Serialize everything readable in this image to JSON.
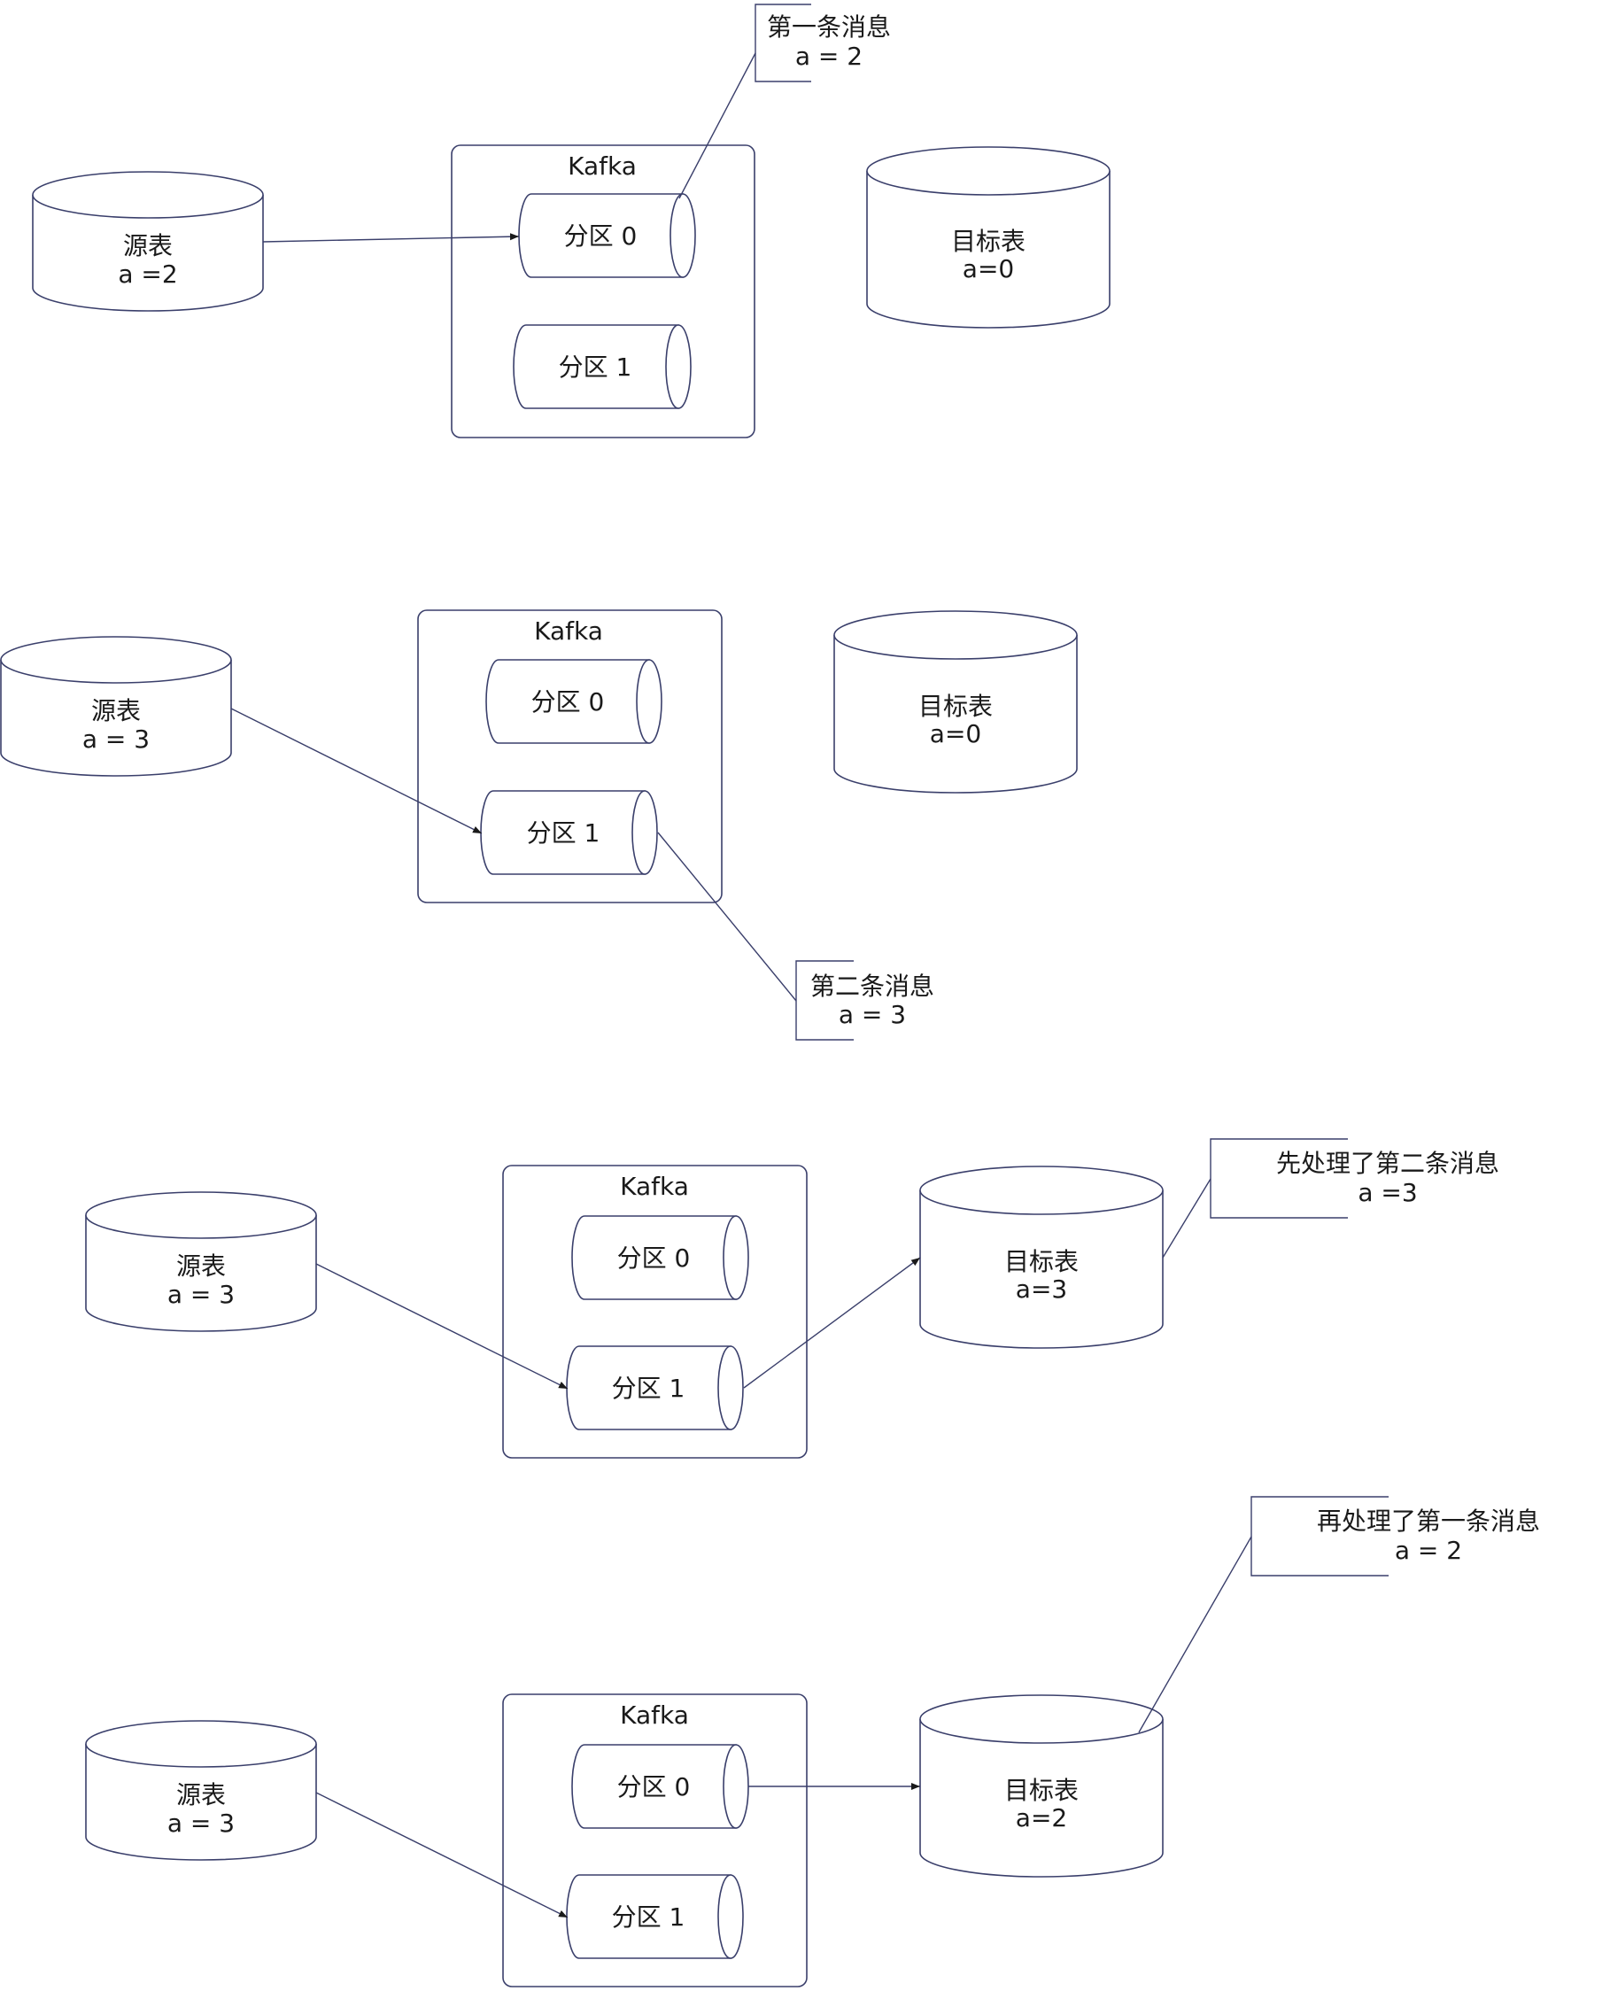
{
  "panels": [
    {
      "source": {
        "title": "源表",
        "value": "a =2"
      },
      "kafka": {
        "title": "Kafka",
        "partition0": "分区 0",
        "partition1": "分区 1"
      },
      "target": {
        "title": "目标表",
        "value": "a=0"
      },
      "callout": {
        "line1": "第一条消息",
        "line2": "a = 2"
      }
    },
    {
      "source": {
        "title": "源表",
        "value": "a = 3"
      },
      "kafka": {
        "title": "Kafka",
        "partition0": "分区 0",
        "partition1": "分区 1"
      },
      "target": {
        "title": "目标表",
        "value": "a=0"
      },
      "callout": {
        "line1": "第二条消息",
        "line2": "a = 3"
      }
    },
    {
      "source": {
        "title": "源表",
        "value": "a = 3"
      },
      "kafka": {
        "title": "Kafka",
        "partition0": "分区 0",
        "partition1": "分区 1"
      },
      "target": {
        "title": "目标表",
        "value": "a=3"
      },
      "callout": {
        "line1": "先处理了第二条消息",
        "line2": "a =3"
      }
    },
    {
      "source": {
        "title": "源表",
        "value": "a = 3"
      },
      "kafka": {
        "title": "Kafka",
        "partition0": "分区 0",
        "partition1": "分区 1"
      },
      "target": {
        "title": "目标表",
        "value": "a=2"
      },
      "callout": {
        "line1": "再处理了第一条消息",
        "line2": "a = 2"
      }
    }
  ],
  "colors": {
    "stroke": "#3a3f6b",
    "text": "#1a1a1a",
    "background": "#ffffff"
  }
}
